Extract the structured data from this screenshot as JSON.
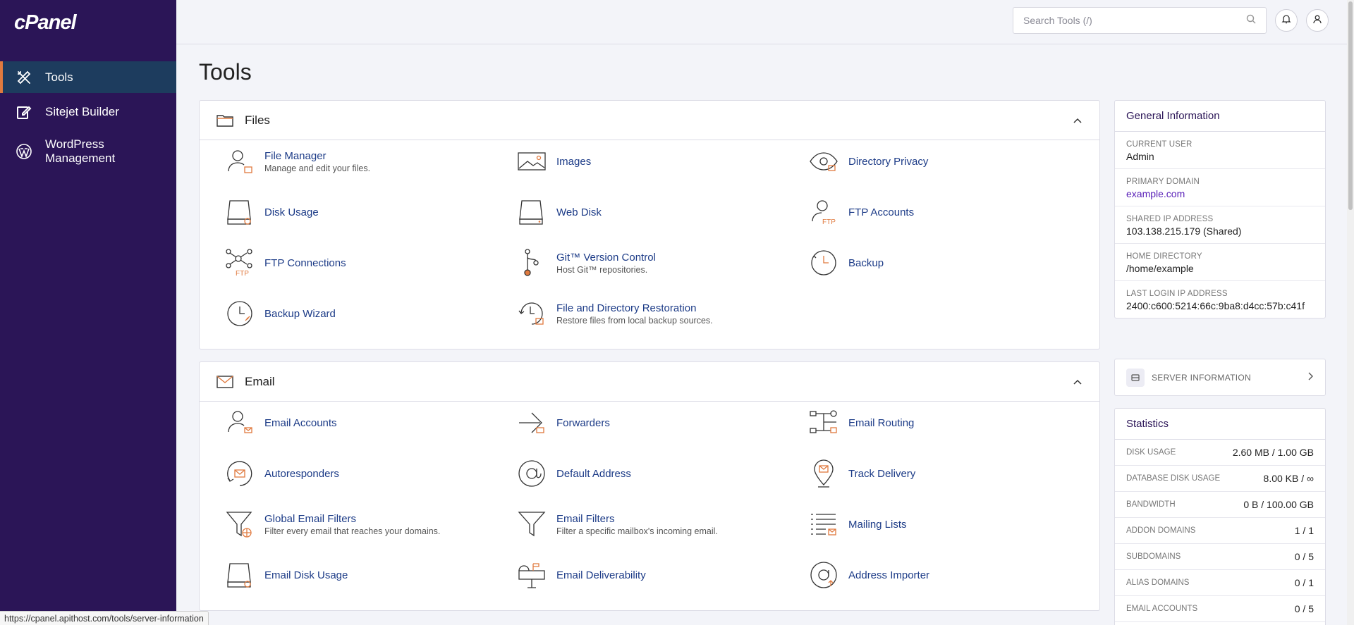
{
  "sidebar": {
    "logo": "cPanel",
    "items": [
      {
        "label": "Tools",
        "icon": "tools-icon"
      },
      {
        "label": "Sitejet Builder",
        "icon": "edit-icon"
      },
      {
        "label": "WordPress Management",
        "icon": "wordpress-icon"
      }
    ]
  },
  "header": {
    "search_placeholder": "Search Tools (/)"
  },
  "main": {
    "title": "Tools",
    "files": {
      "title": "Files",
      "tools": [
        {
          "name": "File Manager",
          "desc": "Manage and edit your files."
        },
        {
          "name": "Images",
          "desc": ""
        },
        {
          "name": "Directory Privacy",
          "desc": ""
        },
        {
          "name": "Disk Usage",
          "desc": ""
        },
        {
          "name": "Web Disk",
          "desc": ""
        },
        {
          "name": "FTP Accounts",
          "desc": ""
        },
        {
          "name": "FTP Connections",
          "desc": ""
        },
        {
          "name": "Git™ Version Control",
          "desc": "Host Git™ repositories."
        },
        {
          "name": "Backup",
          "desc": ""
        },
        {
          "name": "Backup Wizard",
          "desc": ""
        },
        {
          "name": "File and Directory Restoration",
          "desc": "Restore files from local backup sources."
        }
      ]
    },
    "email": {
      "title": "Email",
      "tools": [
        {
          "name": "Email Accounts",
          "desc": ""
        },
        {
          "name": "Forwarders",
          "desc": ""
        },
        {
          "name": "Email Routing",
          "desc": ""
        },
        {
          "name": "Autoresponders",
          "desc": ""
        },
        {
          "name": "Default Address",
          "desc": ""
        },
        {
          "name": "Track Delivery",
          "desc": ""
        },
        {
          "name": "Global Email Filters",
          "desc": "Filter every email that reaches your domains."
        },
        {
          "name": "Email Filters",
          "desc": "Filter a specific mailbox's incoming email."
        },
        {
          "name": "Mailing Lists",
          "desc": ""
        },
        {
          "name": "Email Disk Usage",
          "desc": ""
        },
        {
          "name": "Email Deliverability",
          "desc": ""
        },
        {
          "name": "Address Importer",
          "desc": ""
        }
      ]
    }
  },
  "general_info": {
    "title": "General Information",
    "rows": [
      {
        "label": "Current User",
        "value": "Admin"
      },
      {
        "label": "Primary Domain",
        "value": "example.com"
      },
      {
        "label": "Shared IP Address",
        "value": "103.138.215.179 (Shared)"
      },
      {
        "label": "Home Directory",
        "value": "/home/example"
      },
      {
        "label": "Last Login IP Address",
        "value": "2400:c600:5214:66c:9ba8:d4cc:57b:c41f"
      }
    ]
  },
  "server_info": {
    "label": "SERVER INFORMATION"
  },
  "statistics": {
    "title": "Statistics",
    "rows": [
      {
        "label": "Disk Usage",
        "value": "2.60 MB / 1.00 GB"
      },
      {
        "label": "Database Disk Usage",
        "value": "8.00 KB / ∞"
      },
      {
        "label": "Bandwidth",
        "value": "0 B / 100.00 GB"
      },
      {
        "label": "Addon Domains",
        "value": "1 / 1"
      },
      {
        "label": "Subdomains",
        "value": "0 / 5"
      },
      {
        "label": "Alias Domains",
        "value": "0 / 1"
      },
      {
        "label": "Email Accounts",
        "value": "0 / 5"
      }
    ]
  },
  "status_bar": {
    "url": "https://cpanel.apithost.com/tools/server-information"
  },
  "colors": {
    "sidebar_bg": "#2b1557",
    "active_item_bg": "#1d3c5e",
    "accent_orange": "#e07a3f",
    "link_blue": "#1c3b87"
  }
}
